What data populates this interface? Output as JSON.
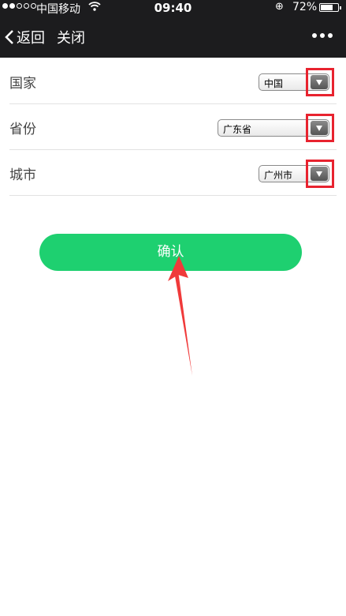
{
  "status_bar": {
    "carrier": "中国移动",
    "time": "09:40",
    "battery_percent": "72%",
    "battery_level": 0.72,
    "signal_strength": 2
  },
  "nav": {
    "back_label": "返回",
    "close_label": "关闭",
    "more_icon": "more-dots-icon"
  },
  "form": {
    "country": {
      "label": "国家",
      "value": "中国"
    },
    "province": {
      "label": "省份",
      "value": "广东省"
    },
    "city": {
      "label": "城市",
      "value": "广州市"
    }
  },
  "confirm_label": "确认",
  "colors": {
    "header_bg": "#1c1c1e",
    "button_green": "#1ed070",
    "highlight_red": "#e8232f"
  }
}
